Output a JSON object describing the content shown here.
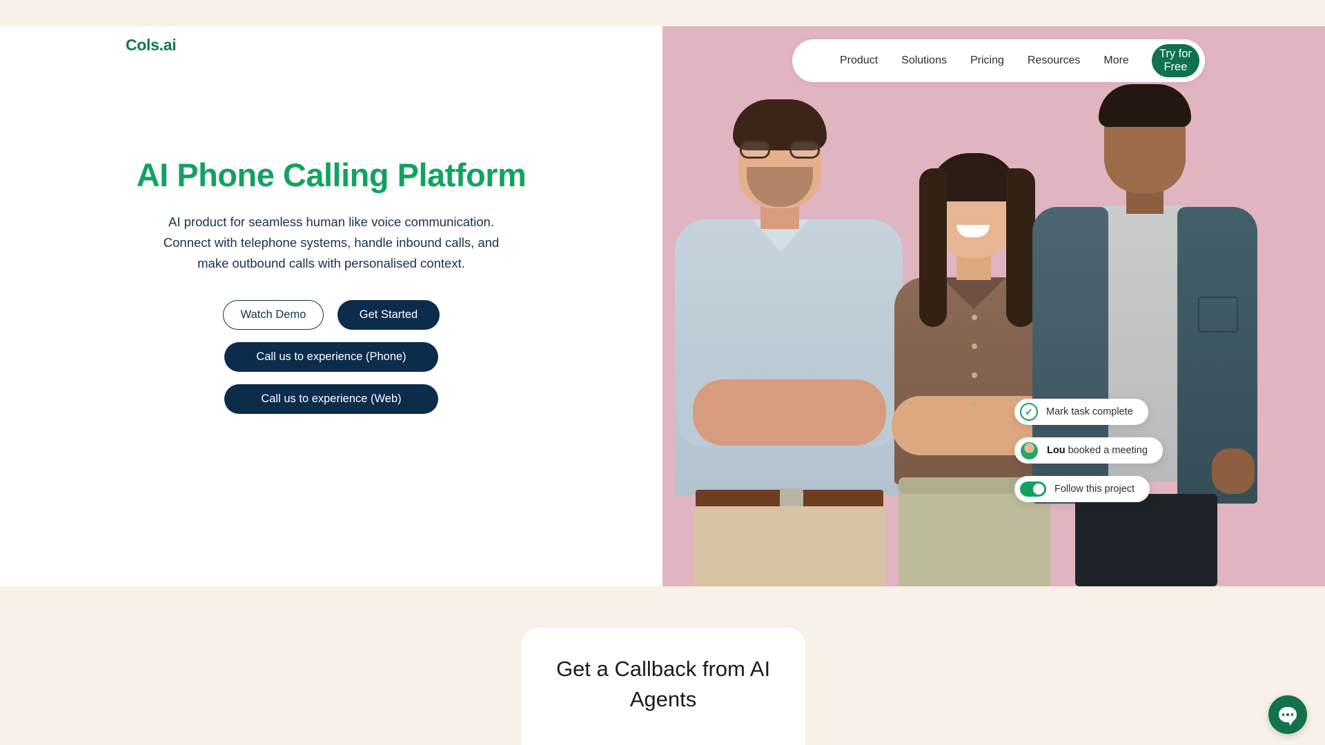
{
  "brand": {
    "name": "Cols.ai"
  },
  "nav": {
    "links": [
      {
        "label": "Product"
      },
      {
        "label": "Solutions"
      },
      {
        "label": "Pricing"
      },
      {
        "label": "Resources"
      },
      {
        "label": "More"
      }
    ],
    "cta_label": "Try for Free"
  },
  "hero": {
    "title": "AI Phone Calling Platform",
    "subtitle": "AI product for seamless human like voice communication. Connect with telephone systems, handle inbound calls, and make outbound calls with personalised context.",
    "buttons": {
      "watch_demo": "Watch Demo",
      "get_started": "Get Started",
      "call_phone": "Call us to experience (Phone)",
      "call_web": "Call us to experience (Web)"
    }
  },
  "notifications": [
    {
      "icon": "check-circle-icon",
      "text": "Mark task complete",
      "bold": ""
    },
    {
      "icon": "avatar",
      "bold": "Lou",
      "text": " booked a meeting"
    },
    {
      "icon": "toggle-on",
      "text": "Follow this project",
      "bold": ""
    }
  ],
  "lower_section": {
    "callback_title": "Get a Callback from AI Agents"
  },
  "chat": {
    "icon": "chat-bubble-icon"
  },
  "colors": {
    "cream": "#F8F1E8",
    "pink": "#E0B4C0",
    "brand_green": "#117A4E",
    "heading_green": "#12A260",
    "navy": "#0C2C4C",
    "cta_green": "#0E7250"
  }
}
